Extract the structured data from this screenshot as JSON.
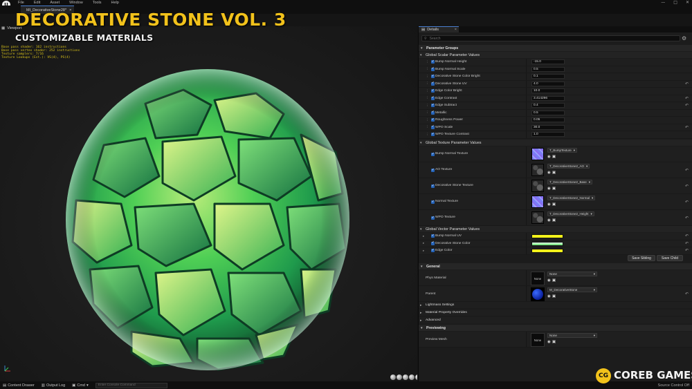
{
  "menu": {
    "file": "File",
    "edit": "Edit",
    "asset": "Asset",
    "window": "Window",
    "tools": "Tools",
    "help": "Help"
  },
  "window_controls": {
    "minimize": "—",
    "maximize": "□",
    "close": "✕"
  },
  "asset_tab": {
    "label": "MI_DecorativeStone28*",
    "close": "×"
  },
  "overlay": {
    "title": "DECORATIVE STONE VOL. 3",
    "subtitle": "CUSTOMIZABLE MATERIALS"
  },
  "viewport": {
    "tab_label": "Viewport",
    "stats": [
      "Base pass shader: 162 instructions",
      "Base pass vertex shader: 252 instructions",
      "Texture samplers: 7/16",
      "Texture Lookups (Est.): VS(4), PS(4)"
    ]
  },
  "details": {
    "tab_label": "Details",
    "tab_close": "×",
    "search_placeholder": "Search",
    "parameter_groups": "Parameter Groups",
    "scalar_group": "Global Scalar Parameter Values",
    "scalar_params": [
      {
        "name": "Bump Normal Height",
        "value": "-15.0",
        "reset": false
      },
      {
        "name": "Bump Normal Scale",
        "value": "0.5",
        "reset": false
      },
      {
        "name": "Decorative Stone Color Bright",
        "value": "0.1",
        "reset": false
      },
      {
        "name": "Decorative Stone UV",
        "value": "4.0",
        "reset": true
      },
      {
        "name": "Edge Color Bright",
        "value": "10.0",
        "reset": false
      },
      {
        "name": "Edge Contrast",
        "value": "3.414296",
        "reset": true
      },
      {
        "name": "Edge Subtract",
        "value": "0.4",
        "reset": true
      },
      {
        "name": "Metallic",
        "value": "0.5",
        "reset": false
      },
      {
        "name": "Roughness Power",
        "value": "0.05",
        "reset": false
      },
      {
        "name": "WPO Scale",
        "value": "30.0",
        "reset": true
      },
      {
        "name": "WPO Texture Contrast",
        "value": "1.0",
        "reset": false
      }
    ],
    "texture_group": "Global Texture Parameter Values",
    "texture_params": [
      {
        "name": "Bump Normal Texture",
        "texture": "T_BumpTexture",
        "thumb": "normal",
        "reset": false
      },
      {
        "name": "AO Texture",
        "texture": "T_DecorativeStone2_AO",
        "thumb": "stone",
        "reset": true
      },
      {
        "name": "Decorative Stone Texture",
        "texture": "T_DecorativeStone2_Base",
        "thumb": "stone",
        "reset": true
      },
      {
        "name": "Normal Texture",
        "texture": "T_DecorativeStone2_Normal",
        "thumb": "normal",
        "reset": true
      },
      {
        "name": "WPO Texture",
        "texture": "T_DecorativeStone2_Height",
        "thumb": "stone",
        "reset": true
      }
    ],
    "vector_group": "Global Vector Parameter Values",
    "vector_params": [
      {
        "name": "Bump Normal UV",
        "color": "#f3f21b",
        "style": "solid",
        "reset": true
      },
      {
        "name": "Decorative Stone Color",
        "color": "#a6f5a8",
        "style": "gradient",
        "reset": true
      },
      {
        "name": "Edge Color",
        "color": "#f3f21b",
        "style": "solid",
        "reset": true
      }
    ],
    "save_sibling": "Save Sibling",
    "save_child": "Save Child",
    "general": {
      "header": "General",
      "phys_material_label": "Phys Material",
      "phys_material_value": "None",
      "phys_thumb_label": "None",
      "parent_label": "Parent",
      "parent_value": "M_DecorativeStone"
    },
    "collapsed_sections": [
      "Lightmass Settings",
      "Material Property Overrides",
      "Advanced"
    ],
    "previewing": {
      "header": "Previewing",
      "preview_mesh_label": "Preview Mesh",
      "preview_mesh_value": "None",
      "preview_thumb_label": "None"
    }
  },
  "bottom_bar": {
    "content_drawer": "Content Drawer",
    "output_log": "Output Log",
    "cmd": "Cmd",
    "console_placeholder": "Enter Console Command",
    "source_control": "Source Control Off"
  },
  "brand": {
    "badge": "CG",
    "name": "COREB GAMES"
  },
  "colors": {
    "accent_yellow": "#f2c21b",
    "checkbox_blue": "#2563b8"
  }
}
